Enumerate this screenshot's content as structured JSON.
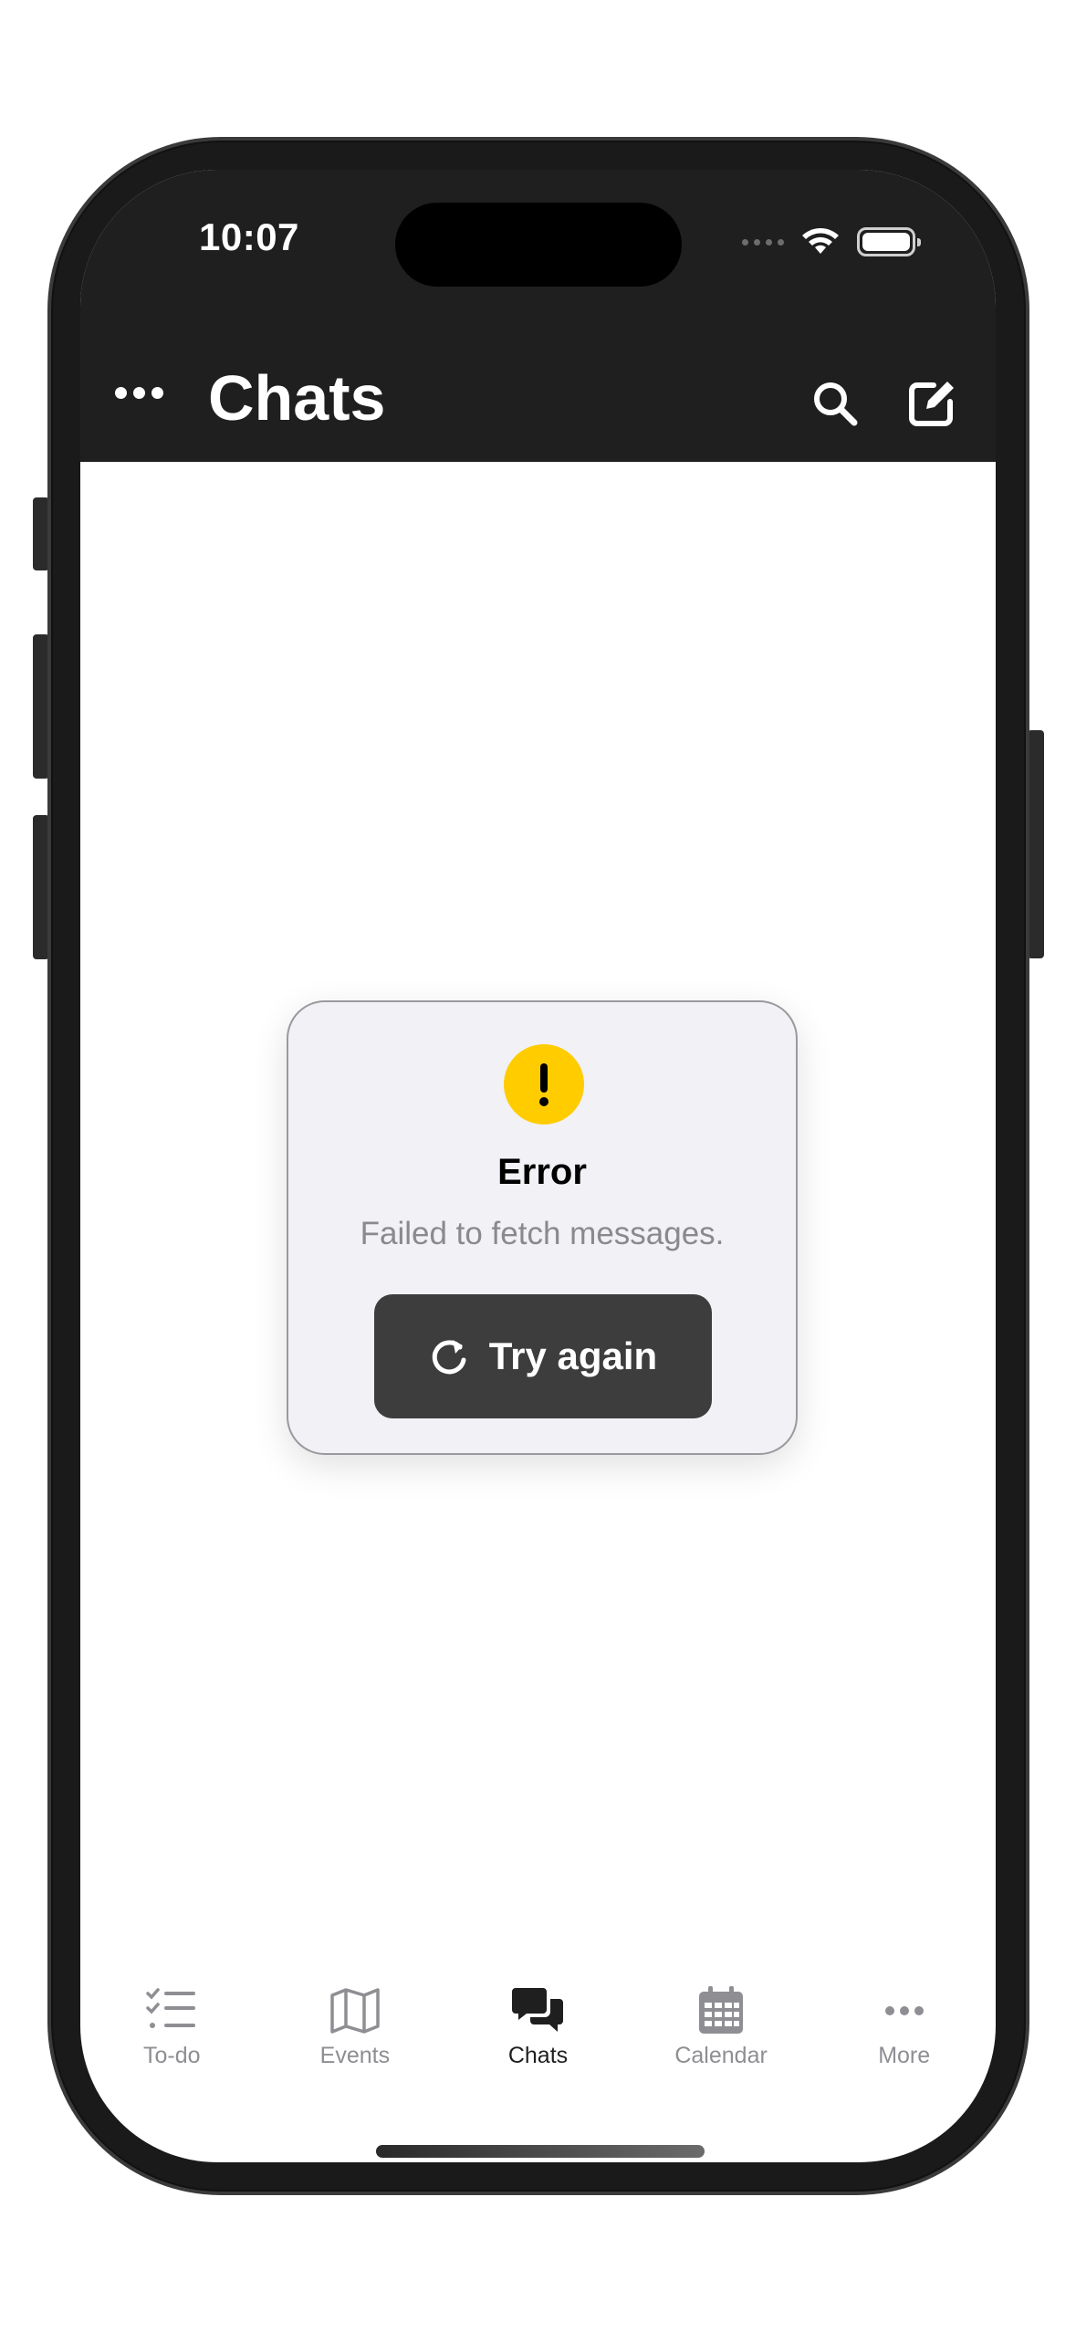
{
  "status_bar": {
    "time": "10:07"
  },
  "header": {
    "title": "Chats"
  },
  "error_card": {
    "title": "Error",
    "message": "Failed to fetch messages.",
    "retry_label": "Try again",
    "accent_color": "#ffcc00"
  },
  "tabbar": {
    "items": [
      {
        "label": "To-do",
        "icon": "checklist-icon",
        "active": false
      },
      {
        "label": "Events",
        "icon": "map-icon",
        "active": false
      },
      {
        "label": "Chats",
        "icon": "chat-bubbles-icon",
        "active": true
      },
      {
        "label": "Calendar",
        "icon": "calendar-icon",
        "active": false
      },
      {
        "label": "More",
        "icon": "more-dots-icon",
        "active": false
      }
    ]
  }
}
